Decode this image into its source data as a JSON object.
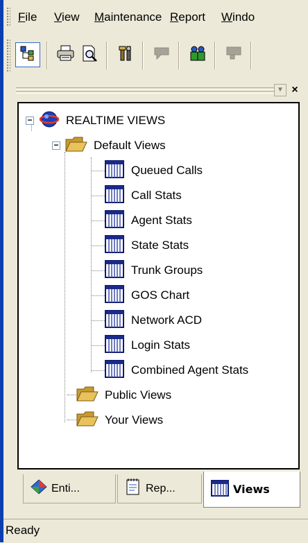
{
  "menu": {
    "items": [
      {
        "label": "File"
      },
      {
        "label": "View"
      },
      {
        "label": "Maintenance"
      },
      {
        "label": "Report"
      },
      {
        "label": "Windo"
      }
    ]
  },
  "toolbar": {
    "buttons": [
      {
        "icon": "tree-view-icon",
        "active": true
      },
      {
        "icon": "printer-icon"
      },
      {
        "icon": "print-preview-icon"
      },
      {
        "icon": "tools-icon"
      },
      {
        "icon": "message-icon"
      },
      {
        "icon": "users-icon"
      },
      {
        "icon": "chat-icon"
      }
    ]
  },
  "tree": {
    "root": {
      "label": "REALTIME VIEWS",
      "icon": "realtime-globe-icon"
    },
    "default_views": {
      "label": "Default Views",
      "children": [
        {
          "label": "Queued Calls"
        },
        {
          "label": "Call Stats"
        },
        {
          "label": "Agent Stats"
        },
        {
          "label": "State Stats"
        },
        {
          "label": "Trunk Groups"
        },
        {
          "label": "GOS Chart"
        },
        {
          "label": "Network ACD"
        },
        {
          "label": "Login Stats"
        },
        {
          "label": "Combined Agent Stats"
        }
      ]
    },
    "public_views": {
      "label": "Public Views"
    },
    "your_views": {
      "label": "Your Views"
    }
  },
  "tabs": [
    {
      "label": "Enti...",
      "icon": "entity-diamond-icon"
    },
    {
      "label": "Rep...",
      "icon": "report-notepad-icon"
    },
    {
      "label": "Views",
      "icon": "views-grid-icon",
      "active": true
    }
  ],
  "status": {
    "text": "Ready"
  },
  "colors": {
    "accent_strip": "#0a3fb0",
    "chrome": "#ece9d8",
    "folder": "#d8b24a",
    "view_icon": "#1a2a8a"
  }
}
